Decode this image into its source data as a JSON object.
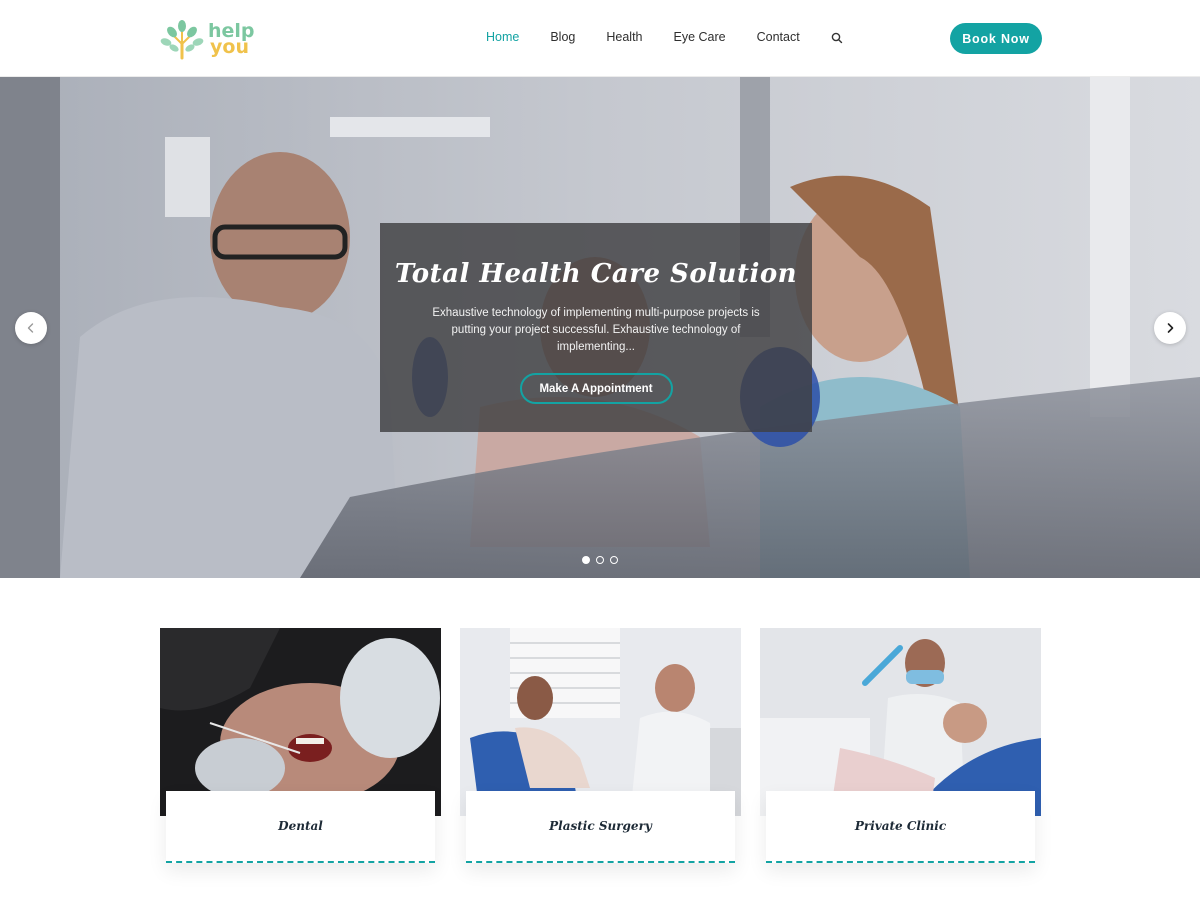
{
  "header": {
    "logo": {
      "line1": "help",
      "line2": "you"
    },
    "nav": [
      {
        "label": "Home",
        "active": true
      },
      {
        "label": "Blog",
        "active": false
      },
      {
        "label": "Health",
        "active": false
      },
      {
        "label": "Eye Care",
        "active": false
      },
      {
        "label": "Contact",
        "active": false
      }
    ],
    "search_icon": "search-icon",
    "book_button": "Book Now"
  },
  "hero": {
    "title": "Total Health Care Solution",
    "description": "Exhaustive technology of implementing multi-purpose projects is putting your project successful. Exhaustive technology of implementing...",
    "button": "Make A Appointment",
    "slides": 3,
    "active_slide": 1,
    "prev_icon": "chevron-left-icon",
    "next_icon": "chevron-right-icon"
  },
  "cards": [
    {
      "title": "Dental"
    },
    {
      "title": "Plastic Surgery"
    },
    {
      "title": "Private Clinic"
    }
  ],
  "colors": {
    "accent": "#13a3a3",
    "logo_green": "#7cc7a0",
    "logo_yellow": "#f0c24b"
  }
}
